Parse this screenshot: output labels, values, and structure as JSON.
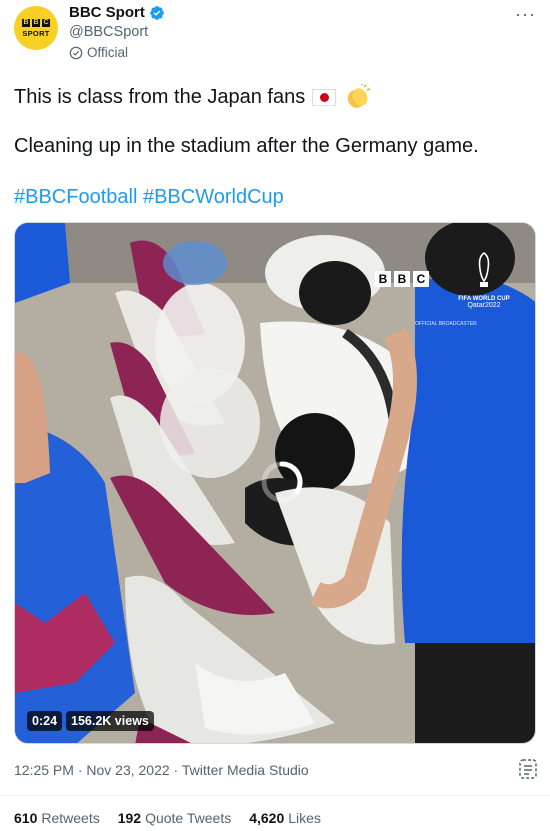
{
  "author": {
    "avatar_top": "BBC",
    "avatar_bottom": "SPORT",
    "display_name": "BBC Sport",
    "handle": "@BBCSport",
    "label": "Official",
    "more": "···"
  },
  "tweet": {
    "line1": "This is class from the Japan fans",
    "line2": "Cleaning up in the stadium after the Germany game.",
    "hashtags": [
      "#BBCFootball",
      "#BBCWorldCup"
    ]
  },
  "video": {
    "duration": "0:24",
    "views": "156.2K views",
    "overlay_brand": [
      "B",
      "B",
      "C"
    ],
    "event_title": "FIFA WORLD CUP",
    "event_sub": "Qatar2022",
    "broadcaster": "OFFICIAL BROADCASTER"
  },
  "meta": {
    "text": "12:25 PM · Nov 23, 2022 · Twitter Media Studio"
  },
  "stats": [
    {
      "count": "610",
      "label": "Retweets"
    },
    {
      "count": "192",
      "label": "Quote Tweets"
    },
    {
      "count": "4,620",
      "label": "Likes"
    }
  ],
  "colors": {
    "link": "#1d9bf0",
    "secondary_text": "#536471",
    "avatar_bg": "#f7cf25"
  }
}
